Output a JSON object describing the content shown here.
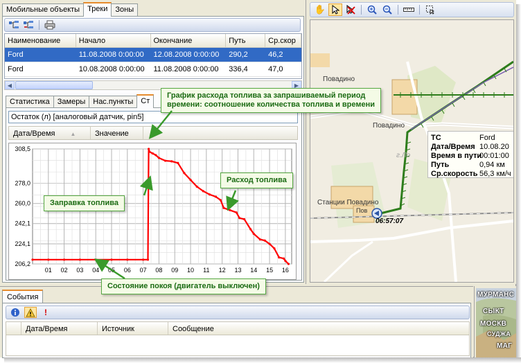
{
  "left": {
    "tabs": [
      {
        "label": "Мобильные объекты"
      },
      {
        "label": "Треки"
      },
      {
        "label": "Зоны"
      }
    ],
    "tracks": {
      "columns": [
        "Наименование",
        "Начало",
        "Окончание",
        "Путь",
        "Ср.скор"
      ],
      "rows": [
        [
          "Ford",
          "11.08.2008 0:00:00",
          "12.08.2008 0:00:00",
          "290,2",
          "46,2"
        ],
        [
          "Ford",
          "10.08.2008 0:00:00",
          "11.08.2008 0:00:00",
          "336,4",
          "47,0"
        ]
      ]
    },
    "subtabs": [
      {
        "label": "Статистика"
      },
      {
        "label": "Замеры"
      },
      {
        "label": "Нас.пункты"
      },
      {
        "label": "Ст"
      }
    ],
    "sensor": "Остаток (л) [аналоговый датчик, pin5]",
    "value_columns": [
      "Дата/Время",
      "Значение"
    ]
  },
  "callouts": {
    "chart": "График расхода топлива за запрашиваемый период\nвремени: соотношение количества топлива и времени",
    "consumption": "Расход топлива",
    "refuel": "Заправка топлива",
    "idle": "Состояние покоя (двигатель выключен)"
  },
  "chart_data": {
    "type": "line",
    "x_ticks": [
      "01",
      "02",
      "03",
      "04",
      "05",
      "06",
      "07",
      "08",
      "09",
      "10",
      "11",
      "12",
      "13",
      "14",
      "15",
      "16"
    ],
    "y_ticks": [
      "206,2",
      "224,1",
      "242,1",
      "260,0",
      "278,0",
      "308,5"
    ],
    "ylim": [
      206.2,
      308.5
    ],
    "xlim": [
      0,
      16.4
    ],
    "grid": true,
    "series": [
      {
        "color": "#ff0000",
        "x": [
          0.0,
          1.0,
          2.0,
          3.0,
          4.0,
          5.0,
          6.0,
          7.0,
          7.3,
          7.35,
          7.4,
          7.6,
          7.8,
          8.0,
          8.4,
          8.8,
          9.2,
          9.6,
          10.0,
          10.4,
          10.8,
          11.2,
          11.6,
          11.9,
          12.1,
          12.5,
          12.9,
          13.1,
          13.4,
          13.8,
          14.0,
          14.4,
          14.7,
          15.0,
          15.3,
          15.6,
          15.9,
          16.0,
          16.2
        ],
        "y": [
          210.0,
          210.0,
          210.0,
          210.0,
          210.0,
          210.0,
          210.0,
          210.0,
          210.0,
          308.5,
          306.0,
          304.5,
          303.0,
          300.5,
          298.0,
          297.5,
          296.0,
          287.0,
          281.0,
          275.0,
          271.0,
          268.0,
          266.0,
          263.0,
          256.0,
          254.0,
          252.0,
          247.0,
          246.0,
          237.0,
          233.0,
          228.0,
          227.0,
          224.0,
          220.0,
          212.0,
          211.0,
          209.0,
          206.2
        ]
      }
    ]
  },
  "map": {
    "toolbar": [
      "hand-tool",
      "select-tool",
      "delete-tool",
      "zoom-in",
      "zoom-out",
      "ruler",
      "area-select"
    ],
    "places": [
      {
        "name": "Повадино"
      },
      {
        "name": "Повадино"
      },
      {
        "name": "Станции Повадино"
      },
      {
        "name": "Пов"
      },
      {
        "name": "г.Ло"
      }
    ],
    "marker_time": "06:57:07",
    "info": [
      {
        "key": "ТС",
        "value": "Ford"
      },
      {
        "key": "Дата/Время",
        "value": "10.08.20"
      },
      {
        "key": "Время в пути",
        "value": "00:01:00"
      },
      {
        "key": "Путь",
        "value": "0,94 км"
      },
      {
        "key": "Ср.скорость",
        "value": "56,3 км/ч"
      }
    ]
  },
  "bottom": {
    "tab": "События",
    "columns": [
      "Дата/Время",
      "Источник",
      "Сообщение"
    ]
  },
  "minimap": {
    "cities": [
      "МУРМАНС",
      "СЫКТ",
      "МОСКВ",
      "СУДЖА",
      "МАГ"
    ]
  }
}
